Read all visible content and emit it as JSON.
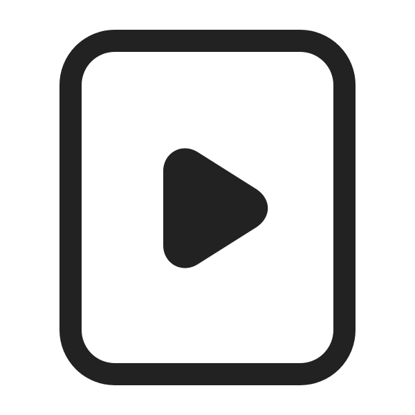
{
  "icon": {
    "name": "document-play-icon",
    "parts": {
      "frame": "document-frame",
      "play": "play-triangle-icon"
    }
  },
  "colors": {
    "background": "#ffffff",
    "stroke": "#222222",
    "fill": "#222222"
  }
}
